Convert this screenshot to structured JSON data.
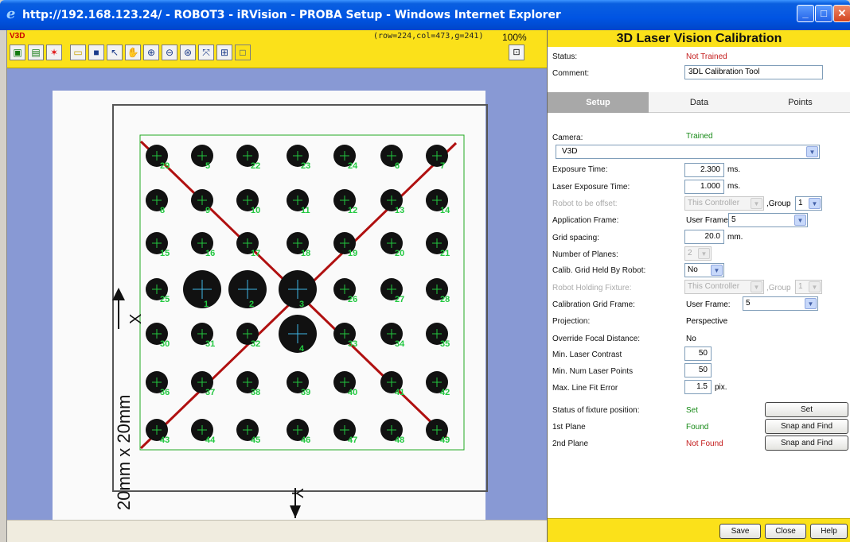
{
  "window": {
    "title": "http://192.168.123.24/ - ROBOT3 - iRVision - PROBA Setup - Windows Internet Explorer"
  },
  "viewer": {
    "label": "V3D",
    "coords": "(row=224,col=473,g=241)",
    "zoom": "100%",
    "tools": [
      "snap",
      "snap-live",
      "laser",
      "open",
      "save",
      "pointer",
      "pan",
      "zoom-in",
      "zoom-out",
      "zoom-fit",
      "zoom-box",
      "grid",
      "blank"
    ]
  },
  "grid_image": {
    "x_axis_label": "X",
    "y_axis_label": "Y",
    "size_label": "20mm x 20mm",
    "dot_numbers": [
      [
        "29",
        "5",
        "22",
        "23",
        "24",
        "6",
        "7"
      ],
      [
        "8",
        "9",
        "10",
        "11",
        "12",
        "13",
        "14"
      ],
      [
        "15",
        "16",
        "17",
        "18",
        "19",
        "20",
        "21"
      ],
      [
        "25",
        "1",
        "2",
        "3",
        "26",
        "27",
        "28"
      ],
      [
        "30",
        "31",
        "32",
        "4",
        "33",
        "34",
        "35"
      ],
      [
        "36",
        "37",
        "38",
        "39",
        "40",
        "41",
        "42"
      ],
      [
        "43",
        "44",
        "45",
        "46",
        "47",
        "48",
        "49"
      ]
    ],
    "colors": {
      "dot": "#111111",
      "marker": "#22c840",
      "big_marker": "#3fb6e8",
      "laser": "#b01010",
      "roi": "#22aa22"
    }
  },
  "panel": {
    "title": "3D Laser Vision Calibration",
    "status_label": "Status:",
    "status_value": "Not Trained",
    "comment_label": "Comment:",
    "comment_value": "3DL Calibration Tool",
    "tabs": [
      "Setup",
      "Data",
      "Points"
    ],
    "camera_label": "Camera:",
    "camera_status": "Trained",
    "camera_value": "V3D",
    "exposure_label": "Exposure Time:",
    "exposure_value": "2.300",
    "exposure_unit": "ms.",
    "laser_exposure_label": "Laser Exposure Time:",
    "laser_exposure_value": "1.000",
    "laser_exposure_unit": "ms.",
    "robot_offset_label": "Robot to be offset:",
    "robot_offset_value": "This Controller",
    "group_label": ",Group",
    "group_value": "1",
    "app_frame_label": "Application Frame:",
    "app_frame_type": "User Frame:",
    "app_frame_value": "5",
    "grid_spacing_label": "Grid spacing:",
    "grid_spacing_value": "20.0",
    "grid_spacing_unit": "mm.",
    "num_planes_label": "Number of Planes:",
    "num_planes_value": "2",
    "held_by_robot_label": "Calib. Grid Held By Robot:",
    "held_by_robot_value": "No",
    "holding_fixture_label": "Robot Holding Fixture:",
    "holding_fixture_value": "This Controller",
    "holding_group_label": ",Group",
    "holding_group_value": "1",
    "cal_grid_frame_label": "Calibration Grid Frame:",
    "cal_grid_frame_type": "User Frame:",
    "cal_grid_frame_value": "5",
    "projection_label": "Projection:",
    "projection_value": "Perspective",
    "override_focal_label": "Override Focal Distance:",
    "override_focal_value": "No",
    "min_contrast_label": "Min. Laser Contrast",
    "min_contrast_value": "50",
    "min_points_label": "Min. Num Laser Points",
    "min_points_value": "50",
    "max_fit_label": "Max. Line Fit Error",
    "max_fit_value": "1.5",
    "max_fit_unit": "pix.",
    "fixture_status_label": "Status of fixture position:",
    "fixture_status_value": "Set",
    "set_button": "Set",
    "plane1_label": "1st Plane",
    "plane1_value": "Found",
    "plane2_label": "2nd Plane",
    "plane2_value": "Not Found",
    "snap_button": "Snap and Find",
    "footer": {
      "save": "Save",
      "close": "Close",
      "help": "Help"
    }
  }
}
